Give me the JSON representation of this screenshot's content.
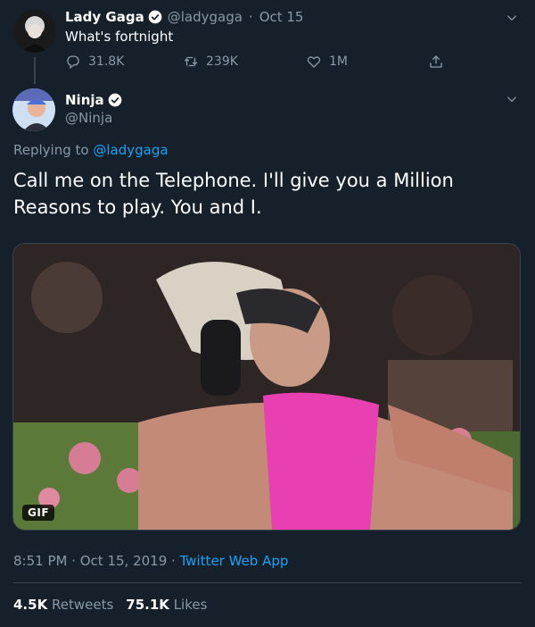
{
  "parent_tweet": {
    "author_name": "Lady Gaga",
    "handle": "@ladygaga",
    "separator": "·",
    "date": "Oct 15",
    "text": "What's fortnight",
    "replies": "31.8K",
    "retweets": "239K",
    "likes": "1M"
  },
  "main_tweet": {
    "author_name": "Ninja",
    "handle": "@Ninja",
    "replying_prefix": "Replying to",
    "replying_to": "@ladygaga",
    "text": "Call me on the Telephone. I'll give you a Million Reasons to play. You and I.",
    "media_badge": "GIF",
    "time": "8:51 PM · Oct 15, 2019 · ",
    "source": "Twitter Web App",
    "retweets_count": "4.5K",
    "retweets_label": "Retweets",
    "likes_count": "75.1K",
    "likes_label": "Likes"
  },
  "colors": {
    "background": "#15202b",
    "muted": "#8899a6",
    "accent": "#1da1f2",
    "divider": "#38444d"
  },
  "icons": {
    "reply": "reply-icon",
    "retweet": "retweet-icon",
    "like": "heart-icon",
    "share": "share-icon",
    "verified": "verified-badge-icon",
    "more": "chevron-down-icon"
  }
}
